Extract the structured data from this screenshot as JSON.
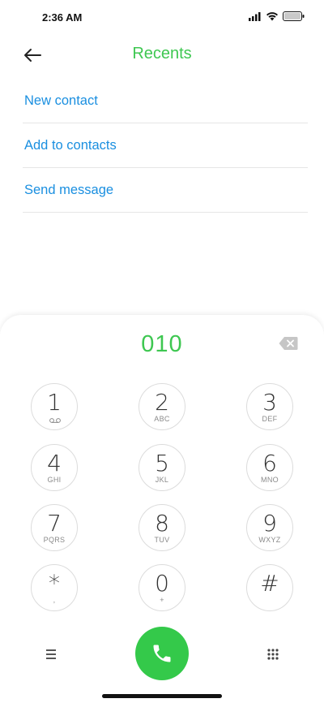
{
  "status_bar": {
    "time": "2:36 AM",
    "icons": [
      "signal-icon",
      "wifi-icon",
      "battery-icon"
    ]
  },
  "header": {
    "title": "Recents",
    "back_icon": "back-arrow-icon"
  },
  "actions": [
    {
      "label": "New contact"
    },
    {
      "label": "Add to contacts"
    },
    {
      "label": "Send message"
    }
  ],
  "dialer": {
    "number": "010",
    "backspace_icon": "backspace-icon",
    "keys": [
      {
        "digit": "1",
        "letters": "",
        "voicemail": true
      },
      {
        "digit": "2",
        "letters": "ABC"
      },
      {
        "digit": "3",
        "letters": "DEF"
      },
      {
        "digit": "4",
        "letters": "GHI"
      },
      {
        "digit": "5",
        "letters": "JKL"
      },
      {
        "digit": "6",
        "letters": "MNO"
      },
      {
        "digit": "7",
        "letters": "PQRS"
      },
      {
        "digit": "8",
        "letters": "TUV"
      },
      {
        "digit": "9",
        "letters": "WXYZ"
      },
      {
        "digit": "*",
        "letters": ","
      },
      {
        "digit": "0",
        "letters": "+"
      },
      {
        "digit": "#",
        "letters": ""
      }
    ]
  },
  "bottom_bar": {
    "menu_icon": "menu-icon",
    "call_icon": "phone-icon",
    "keypad_icon": "keypad-grid-icon"
  },
  "colors": {
    "accent_green": "#3ec751",
    "link_blue": "#1a8fe0",
    "call_button": "#34c94a"
  }
}
